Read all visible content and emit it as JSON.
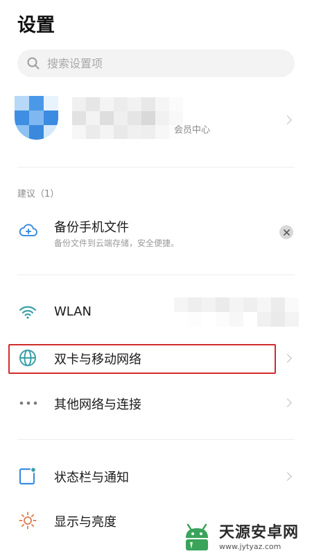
{
  "page_title": "设置",
  "search": {
    "placeholder": "搜索设置项",
    "value": ""
  },
  "account": {
    "member_center": "会员中心"
  },
  "suggestions": {
    "section_label": "建议（1）",
    "item": {
      "title": "备份手机文件",
      "subtitle": "备份文件到云端存储，安全便捷。"
    }
  },
  "network": {
    "items": [
      {
        "label": "WLAN"
      },
      {
        "label": "双卡与移动网络"
      },
      {
        "label": "其他网络与连接"
      }
    ]
  },
  "display_items": [
    {
      "label": "状态栏与通知"
    },
    {
      "label": "显示与亮度"
    }
  ],
  "watermark": {
    "title": "天源安卓网",
    "url": "www.jytyaz.com"
  },
  "colors": {
    "accent_blue": "#3c8de0",
    "wifi_teal": "#3a9fa8",
    "highlight_red": "#d02b2b",
    "sun_orange": "#e0855a"
  }
}
